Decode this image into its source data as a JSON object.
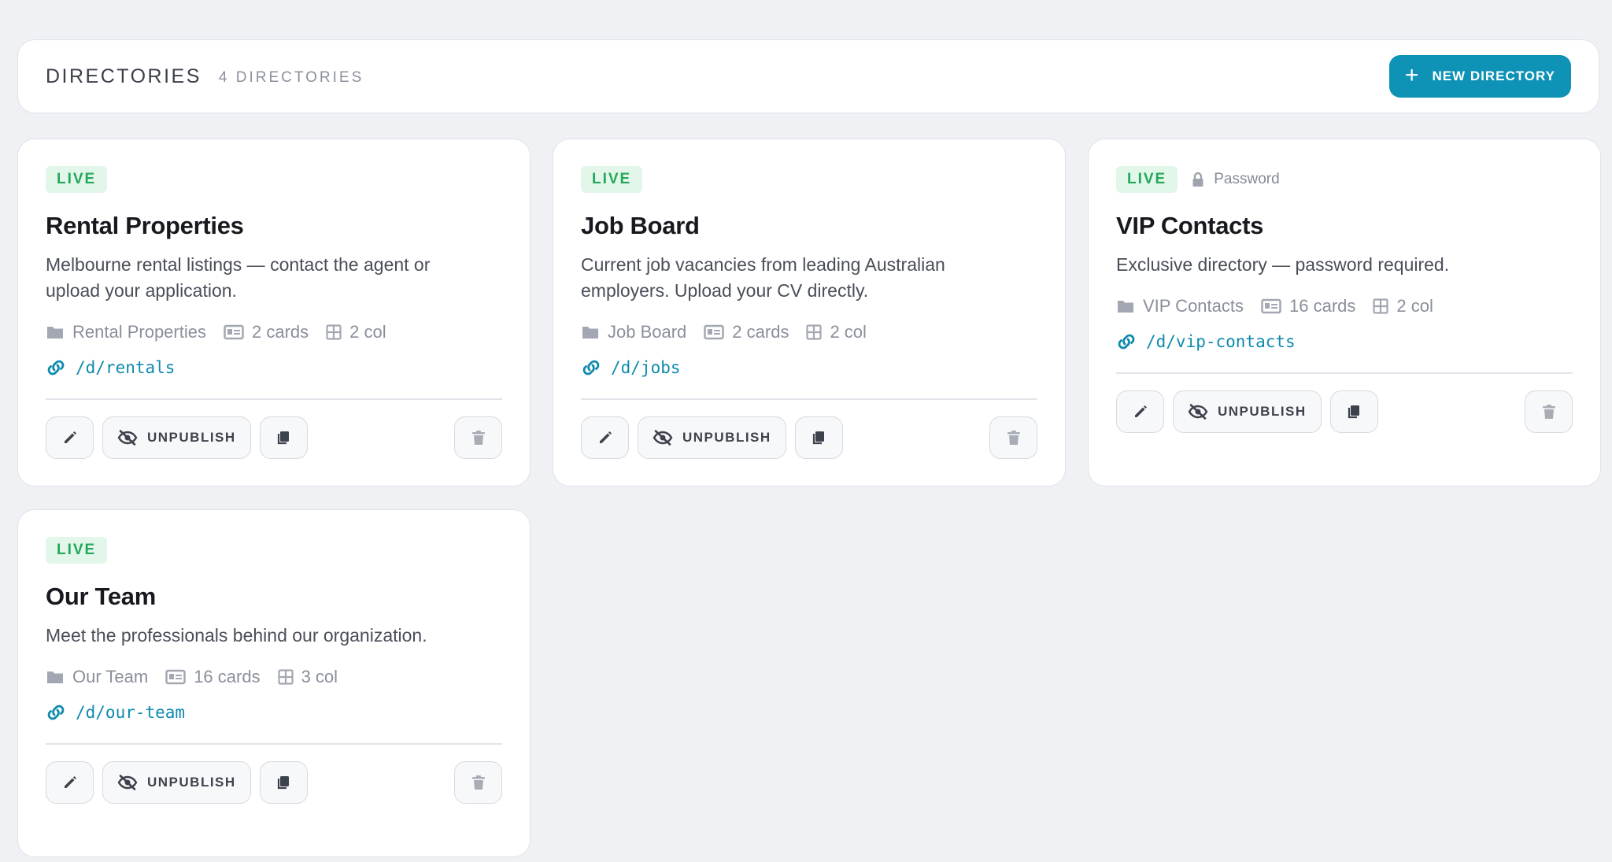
{
  "header": {
    "title": "DIRECTORIES",
    "count": "4 DIRECTORIES",
    "new_button": "NEW DIRECTORY"
  },
  "cards": [
    {
      "status": "LIVE",
      "title": "Rental Properties",
      "description": "Melbourne rental listings — contact the agent or upload your application.",
      "folder": "Rental Properties",
      "cards_count": "2 cards",
      "columns": "2 col",
      "path": "/d/rentals",
      "unpublish_label": "UNPUBLISH"
    },
    {
      "status": "LIVE",
      "title": "Job Board",
      "description": "Current job vacancies from leading Australian employers. Upload your CV directly.",
      "folder": "Job Board",
      "cards_count": "2 cards",
      "columns": "2 col",
      "path": "/d/jobs",
      "unpublish_label": "UNPUBLISH"
    },
    {
      "status": "LIVE",
      "protection": "Password",
      "title": "VIP Contacts",
      "description": "Exclusive directory — password required.",
      "folder": "VIP Contacts",
      "cards_count": "16 cards",
      "columns": "2 col",
      "path": "/d/vip-contacts",
      "unpublish_label": "UNPUBLISH"
    },
    {
      "status": "LIVE",
      "title": "Our Team",
      "description": "Meet the professionals behind our organization.",
      "folder": "Our Team",
      "cards_count": "16 cards",
      "columns": "3 col",
      "path": "/d/our-team",
      "unpublish_label": "UNPUBLISH"
    }
  ],
  "colors": {
    "accent": "#0e93b6",
    "live_text": "#22a85a",
    "live_bg": "#e3f6ea",
    "link": "#0e8aad",
    "background": "#f0f1f5"
  },
  "icons": [
    "plus-icon",
    "lock-icon",
    "folder-icon",
    "id-card-icon",
    "grid-icon",
    "link-icon",
    "pencil-icon",
    "eye-slash-icon",
    "copy-icon",
    "trash-icon"
  ]
}
